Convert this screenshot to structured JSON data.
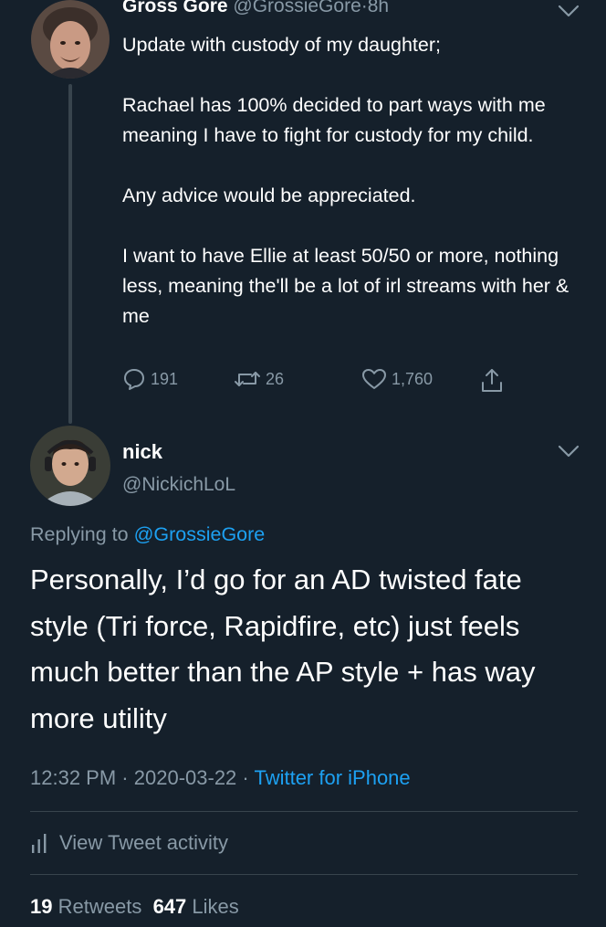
{
  "parent_tweet": {
    "display_name": "Gross Gore",
    "handle": "@GrossieGore",
    "separator": "·",
    "time_ago": "8h",
    "paragraphs": [
      "Update with custody of my daughter;",
      "Rachael has 100% decided to part ways with me meaning I have to fight for custody for my child.",
      "Any advice would be appreciated.",
      "I want to have Ellie at least 50/50 or more, nothing less, meaning the'll be a lot of irl streams with her & me"
    ],
    "actions": {
      "reply_count": "191",
      "retweet_count": "26",
      "like_count": "1,760"
    }
  },
  "reply_tweet": {
    "display_name": "nick",
    "handle": "@NickichLoL",
    "replying_prefix": "Replying to",
    "replying_to": "@GrossieGore",
    "text": "Personally, I’d go for an AD twisted fate style (Tri force, Rapidfire, etc) just feels much better than the AP style + has way more utility",
    "time": "12:32 PM",
    "date": "2020-03-22",
    "separator": "·",
    "source": "Twitter for iPhone",
    "activity_label": "View Tweet activity",
    "retweets_count": "19",
    "retweets_label": "Retweets",
    "likes_count": "647",
    "likes_label": "Likes"
  },
  "icons": {
    "reply": "speech-bubble-icon",
    "retweet": "retweet-icon",
    "like": "heart-icon",
    "share": "share-icon",
    "caret": "chevron-down-icon",
    "activity": "bar-chart-icon"
  },
  "colors": {
    "background": "#15202b",
    "text": "#ffffff",
    "muted": "#8899a6",
    "accent": "#1da1f2",
    "divider": "#38444d"
  }
}
